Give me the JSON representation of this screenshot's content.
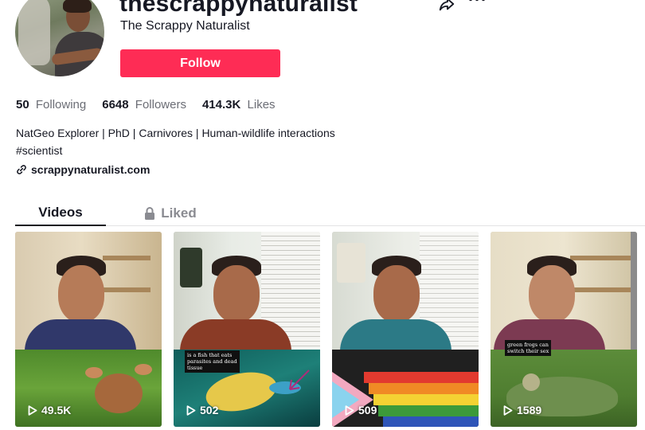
{
  "profile": {
    "username": "thescrappynaturalist",
    "display_name": "The Scrappy Naturalist",
    "follow_label": "Follow"
  },
  "stats": [
    {
      "value": "50",
      "label": "Following"
    },
    {
      "value": "6648",
      "label": "Followers"
    },
    {
      "value": "414.3K",
      "label": "Likes"
    }
  ],
  "bio": {
    "line1": "NatGeo Explorer | PhD | Carnivores | Human-wildlife interactions",
    "line2": "#scientist",
    "link": "scrappynaturalist.com"
  },
  "tabs": {
    "videos": "Videos",
    "liked": "Liked"
  },
  "videos": [
    {
      "views": "49.5K",
      "caption": ""
    },
    {
      "views": "502",
      "caption_line1": "is a fish that eats",
      "caption_line2": "parasites and dead",
      "caption_line3": "tissue"
    },
    {
      "views": "509",
      "caption": ""
    },
    {
      "views": "1589",
      "caption_line1": "green frogs can",
      "caption_line2": "switch their sex"
    }
  ],
  "icons": {
    "share": "share-icon",
    "more": "more-icon",
    "link": "link-icon",
    "lock": "lock-icon",
    "play": "play-icon"
  },
  "colors": {
    "follow": "#fe2c55",
    "text": "#161823",
    "muted": "#8a8b91"
  }
}
